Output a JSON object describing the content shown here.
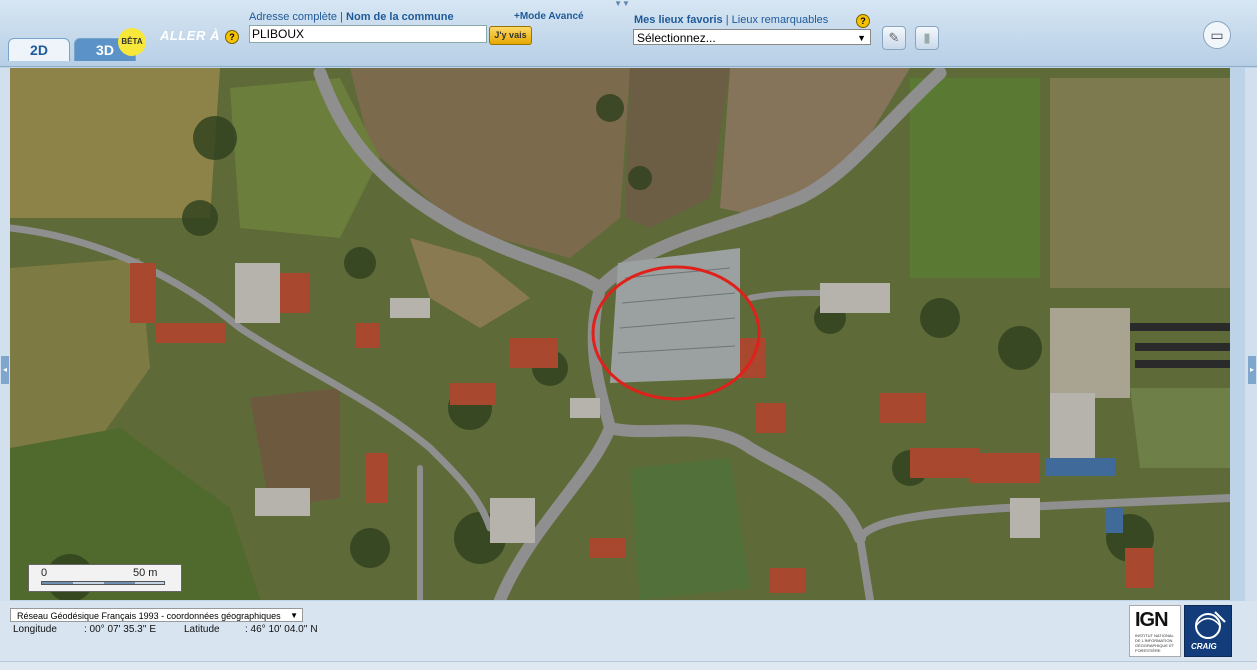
{
  "tabs": {
    "tab_2d": "2D",
    "tab_3d": "3D",
    "beta_badge": "BÊTA"
  },
  "goto": {
    "label": "ALLER À",
    "help": "?",
    "link_full_address": "Adresse complète",
    "separator": "|",
    "link_commune": "Nom de la commune",
    "advanced_mode": "+Mode Avancé",
    "input_value": "PLIBOUX",
    "go_button": "J'y vais"
  },
  "favorites": {
    "link_favorites": "Mes lieux favoris",
    "separator": "|",
    "link_landmarks": "Lieux remarquables",
    "help": "?",
    "select_value": "Sélectionnez..."
  },
  "toolbar": {
    "pin_icon": "pushpin-icon",
    "trash_icon": "trash-icon",
    "screen_icon": "screen-icon"
  },
  "scale": {
    "zero": "0",
    "distance": "50 m"
  },
  "coordinates": {
    "crs_value": "Réseau Géodésique Français 1993 - coordonnées géographiques",
    "longitude_label": "Longitude",
    "longitude_value": ": 00° 07' 35.3'' E",
    "latitude_label": "Latitude",
    "latitude_value": ": 46° 10' 04.0'' N"
  },
  "logos": {
    "ign_text": "IGN",
    "ign_subtext": "INSTITUT NATIONAL DE L'INFORMATION GÉOGRAPHIQUE ET FORESTIÈRE",
    "craig_text": "CRAIG"
  },
  "colors": {
    "accent_blue": "#1f5a98",
    "highlight_circle": "#e0201a",
    "go_button": "#f2c030"
  }
}
